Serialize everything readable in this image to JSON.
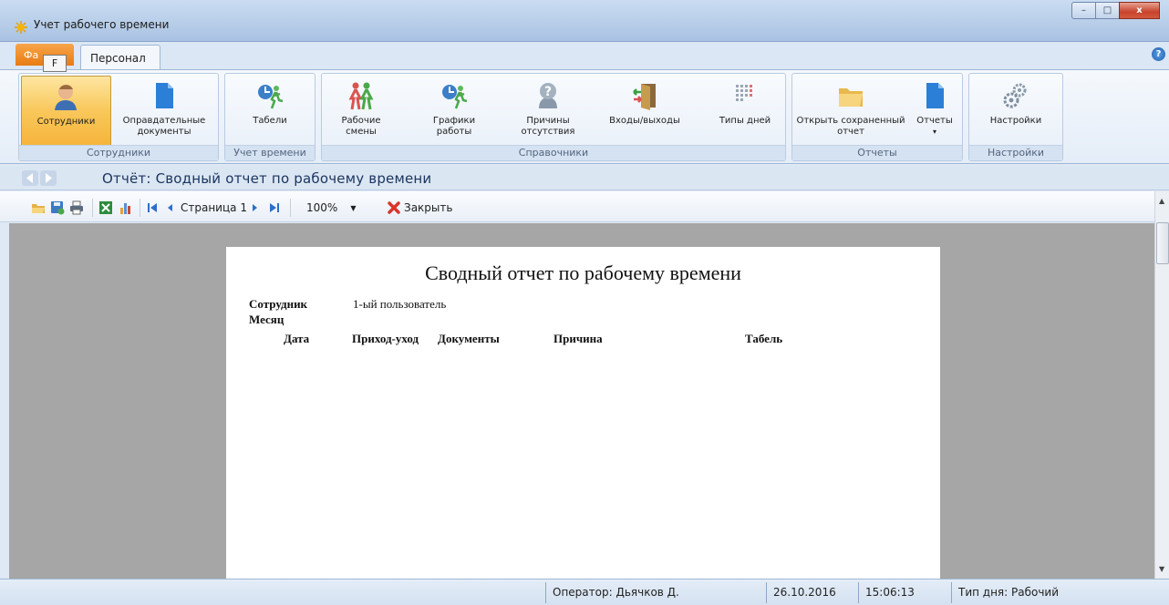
{
  "window": {
    "title": "Учет рабочего времени",
    "buttons": {
      "minimize": "–",
      "maximize": "□",
      "close": "x"
    }
  },
  "ribbon": {
    "file_tab": "Фа",
    "keytip": "F",
    "tabs": [
      "Персонал"
    ],
    "help": "?",
    "groups": [
      {
        "label": "Сотрудники",
        "buttons": [
          {
            "label": "Сотрудники",
            "icon": "employee-icon",
            "active": true
          },
          {
            "label": "Оправдательные документы",
            "icon": "document-icon"
          }
        ]
      },
      {
        "label": "Учет времени",
        "buttons": [
          {
            "label": "Табели",
            "icon": "timesheet-icon"
          }
        ]
      },
      {
        "label": "Справочники",
        "buttons": [
          {
            "label": "Рабочие смены",
            "icon": "shifts-icon"
          },
          {
            "label": "Графики работы",
            "icon": "schedule-icon"
          },
          {
            "label": "Причины отсутствия",
            "icon": "question-icon"
          },
          {
            "label": "Входы/выходы",
            "icon": "door-icon"
          },
          {
            "label": "Типы дней",
            "icon": "calendar-grid-icon"
          }
        ]
      },
      {
        "label": "Отчеты",
        "buttons": [
          {
            "label": "Открыть сохраненный отчет",
            "icon": "folder-icon"
          },
          {
            "label": "Отчеты",
            "icon": "report-icon",
            "has_dropdown": true
          }
        ]
      },
      {
        "label": "Настройки",
        "buttons": [
          {
            "label": "Настройки",
            "icon": "gears-icon"
          }
        ]
      }
    ]
  },
  "navigation": {
    "report_title": "Отчёт: Сводный отчет по рабочему времени"
  },
  "viewer_toolbar": {
    "page_label": "Страница 1",
    "zoom": "100%",
    "close_label": "Закрыть"
  },
  "report": {
    "title": "Сводный отчет по рабочему времени",
    "employee_label": "Сотрудник",
    "employee_value": "1-ый пользователь",
    "month_label": "Месяц",
    "columns": [
      "Дата",
      "Приход-уход",
      "Документы",
      "Причина",
      "Табель"
    ]
  },
  "status_bar": {
    "operator": "Оператор:  Дьячков Д.",
    "date": "26.10.2016",
    "time": "15:06:13",
    "day_type": "Тип дня:  Рабочий"
  },
  "colors": {
    "accent": "#f9c75a",
    "file_tab": "#e87b12",
    "workspace": "#a6a6a6"
  }
}
